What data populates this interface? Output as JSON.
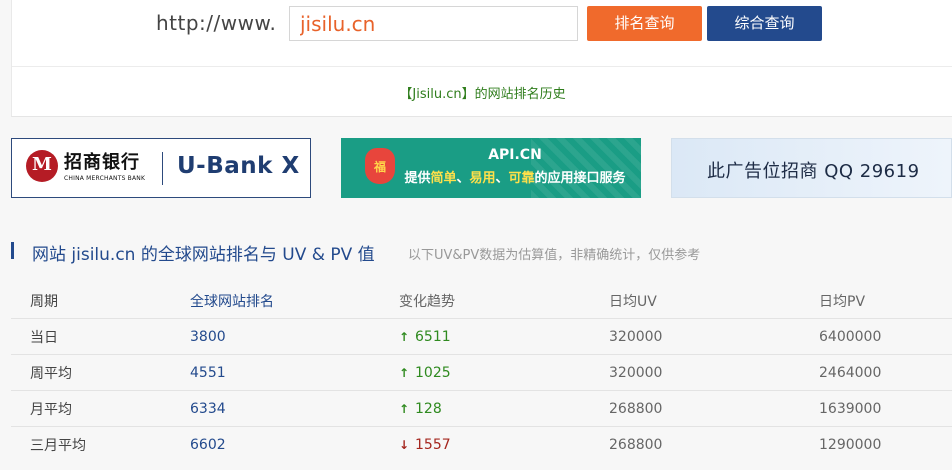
{
  "search": {
    "prefix": "http://www.",
    "domain": "jisilu.cn",
    "rank_button": "排名查询",
    "combined_button": "综合查询",
    "history_link": "【Jisilu.cn】的网站排名历史"
  },
  "ads": {
    "cmb": {
      "logo_mark": "M",
      "name_cn": "招商银行",
      "name_en": "CHINA MERCHANTS BANK",
      "product": "U-Bank X"
    },
    "api": {
      "badge": "福",
      "title": "API.CN",
      "slogan_prefix": "提供",
      "slogan_highlight_1": "简单",
      "slogan_sep_1": "、",
      "slogan_highlight_2": "易用",
      "slogan_sep_2": "、",
      "slogan_highlight_3": "可靠",
      "slogan_suffix": "的应用接口服务"
    },
    "slot": {
      "text": "此广告位招商 QQ 29619"
    }
  },
  "section": {
    "title": "网站 jisilu.cn 的全球网站排名与 UV & PV 值",
    "note": "以下UV&PV数据为估算值，非精确统计，仅供参考"
  },
  "table": {
    "headers": [
      "周期",
      "全球网站排名",
      "变化趋势",
      "日均UV",
      "日均PV"
    ],
    "rows": [
      {
        "period": "当日",
        "rank": "3800",
        "trend": "6511",
        "direction": "up",
        "uv": "320000",
        "pv": "6400000"
      },
      {
        "period": "周平均",
        "rank": "4551",
        "trend": "1025",
        "direction": "up",
        "uv": "320000",
        "pv": "2464000"
      },
      {
        "period": "月平均",
        "rank": "6334",
        "trend": "128",
        "direction": "up",
        "uv": "268800",
        "pv": "1639000"
      },
      {
        "period": "三月平均",
        "rank": "6602",
        "trend": "1557",
        "direction": "down",
        "uv": "268800",
        "pv": "1290000"
      }
    ]
  },
  "icons": {
    "trend_up": "arrow-up-icon",
    "trend_down": "arrow-down-icon"
  },
  "colors": {
    "accent_orange": "#f06a2c",
    "accent_blue": "#234a8d",
    "up_green": "#2f8a1f",
    "down_red": "#a5271f"
  }
}
